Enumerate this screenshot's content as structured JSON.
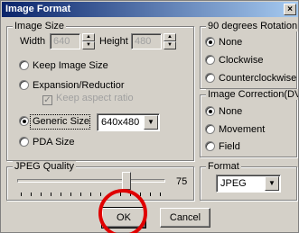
{
  "window": {
    "title": "Image Format",
    "close_glyph": "×"
  },
  "image_size": {
    "legend": "Image Size",
    "width_label": "Width",
    "width_value": "640",
    "height_label": "Height",
    "height_value": "480",
    "options": [
      {
        "label": "Keep Image Size",
        "selected": false
      },
      {
        "label": "Expansion/Reductior",
        "selected": false
      },
      {
        "label": "Generic Size",
        "selected": true
      },
      {
        "label": "PDA Size",
        "selected": false
      }
    ],
    "keep_aspect_label": "Keep aspect ratio",
    "keep_aspect_checked": true,
    "generic_size_value": "640x480"
  },
  "rotation": {
    "legend": "90 degrees Rotation",
    "options": [
      {
        "label": "None",
        "selected": true
      },
      {
        "label": "Clockwise",
        "selected": false
      },
      {
        "label": "Counterclockwise",
        "selected": false
      }
    ]
  },
  "correction": {
    "legend": "Image Correction(DV)",
    "options": [
      {
        "label": "None",
        "selected": true
      },
      {
        "label": "Movement",
        "selected": false
      },
      {
        "label": "Field",
        "selected": false
      }
    ]
  },
  "jpeg_quality": {
    "legend": "JPEG Quality",
    "value": "75",
    "value_fraction": 0.75
  },
  "format": {
    "legend": "Format",
    "value": "JPEG"
  },
  "buttons": {
    "ok": "OK",
    "cancel": "Cancel"
  },
  "colors": {
    "highlight_circle": "#e00000",
    "title_bar": "#0a246a"
  }
}
